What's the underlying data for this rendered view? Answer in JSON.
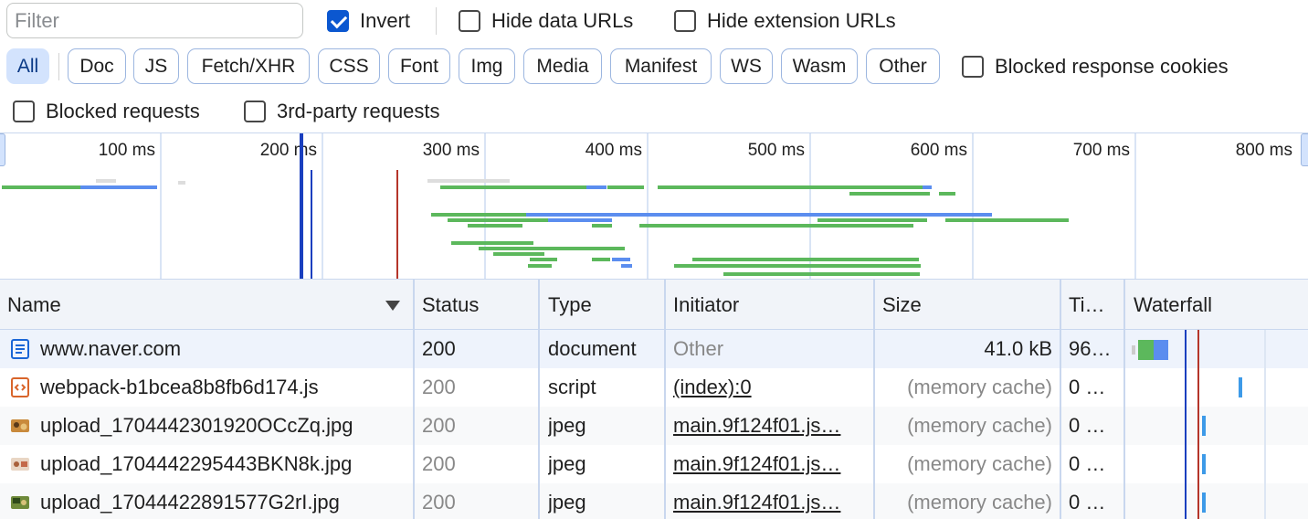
{
  "toolbar": {
    "filter_placeholder": "Filter",
    "invert_label": "Invert",
    "invert_checked": true,
    "hide_data_urls_label": "Hide data URLs",
    "hide_extension_urls_label": "Hide extension URLs"
  },
  "type_filters": [
    "All",
    "Doc",
    "JS",
    "Fetch/XHR",
    "CSS",
    "Font",
    "Img",
    "Media",
    "Manifest",
    "WS",
    "Wasm",
    "Other"
  ],
  "active_filter": "All",
  "blocked_response_cookies_label": "Blocked response cookies",
  "blocked_requests_label": "Blocked requests",
  "third_party_label": "3rd-party requests",
  "overview": {
    "tick_labels": [
      "100 ms",
      "200 ms",
      "300 ms",
      "400 ms",
      "500 ms",
      "600 ms",
      "700 ms",
      "800 ms"
    ]
  },
  "table": {
    "columns": [
      "Name",
      "Status",
      "Type",
      "Initiator",
      "Size",
      "Ti…",
      "Waterfall"
    ],
    "rows": [
      {
        "icon": "document-icon",
        "name": "www.naver.com",
        "status": "200",
        "type": "document",
        "initiator": "Other",
        "size": "41.0 kB",
        "time": "96…"
      },
      {
        "icon": "script-icon",
        "name": "webpack-b1bcea8b8fb6d174.js",
        "status": "200",
        "type": "script",
        "initiator": "(index):0",
        "size": "(memory cache)",
        "time": "0 …"
      },
      {
        "icon": "image-thumbnail-icon",
        "name": "upload_1704442301920OCcZq.jpg",
        "status": "200",
        "type": "jpeg",
        "initiator": "main.9f124f01.js…",
        "size": "(memory cache)",
        "time": "0 …"
      },
      {
        "icon": "image-thumbnail-icon",
        "name": "upload_1704442295443BKN8k.jpg",
        "status": "200",
        "type": "jpeg",
        "initiator": "main.9f124f01.js…",
        "size": "(memory cache)",
        "time": "0 …"
      },
      {
        "icon": "image-thumbnail-icon",
        "name": "upload_17044422891577G2rI.jpg",
        "status": "200",
        "type": "jpeg",
        "initiator": "main.9f124f01.js…",
        "size": "(memory cache)",
        "time": "0 …"
      }
    ]
  },
  "colors": {
    "accent": "#0b57d0",
    "timing_green": "#5cb85c",
    "timing_blue": "#5b8def",
    "dom_content_loaded_line": "#1a3fbf",
    "load_line": "#b5352a"
  }
}
